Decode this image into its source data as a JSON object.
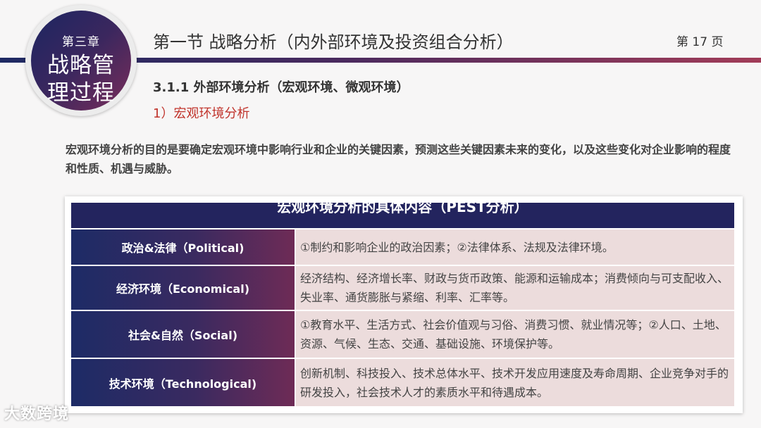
{
  "badge": {
    "chapter": "第三章",
    "line1": "战略管",
    "line2": "理过程"
  },
  "header": {
    "title": "第一节  战略分析（内外部环境及投资组合分析）",
    "page": "第 17 页"
  },
  "section": {
    "heading": "3.1.1 外部环境分析（宏观环境、微观环境）",
    "subheading": "1）宏观环境分析"
  },
  "intro": "宏观环境分析的目的是要确定宏观环境中影响行业和企业的关键因素，预测这些关键因素未来的变化，以及这些变化对企业影响的程度和性质、机遇与威胁。",
  "table": {
    "title": "宏观环境分析的具体内容（PEST分析）",
    "rows": [
      {
        "key": "政治&法律（Political)",
        "value": "①制约和影响企业的政治因素；②法律体系、法规及法律环境。"
      },
      {
        "key": "经济环境（Economical)",
        "value": "经济结构、经济增长率、财政与货币政策、能源和运输成本；消费倾向与可支配收入、失业率、通货膨胀与紧缩、利率、汇率等。"
      },
      {
        "key": "社会&自然（Social)",
        "value": "①教育水平、生活方式、社会价值观与习俗、消费习惯、就业情况等；②人口、土地、资源、气候、生态、交通、基础设施、环境保护等。"
      },
      {
        "key": "技术环境（Technological)",
        "value": "创新机制、科技投入、技术总体水平、技术开发应用速度及寿命周期、企业竞争对手的研发投入，社会技术人才的素质水平和待遇成本。"
      }
    ]
  },
  "watermark": "大数跨境"
}
